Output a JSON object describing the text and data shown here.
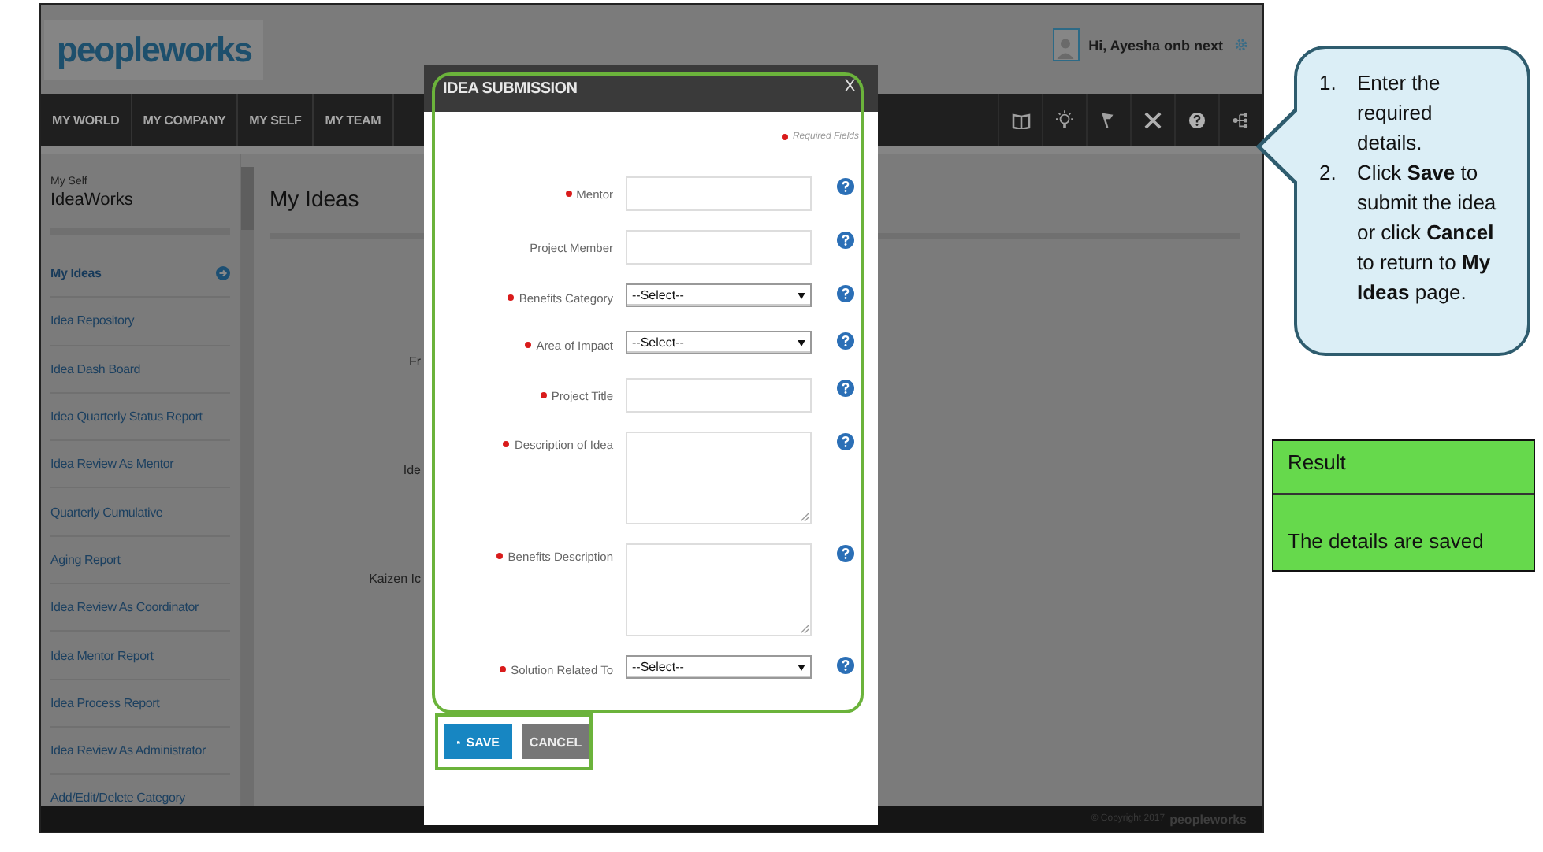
{
  "header": {
    "logo": "peopleworks",
    "greeting": "Hi, Ayesha onb next"
  },
  "nav": {
    "items": [
      {
        "label": "MY WORLD"
      },
      {
        "label": "MY COMPANY"
      },
      {
        "label": "MY SELF"
      },
      {
        "label": "MY TEAM"
      }
    ]
  },
  "sidebar": {
    "section": "My Self",
    "title": "IdeaWorks",
    "items": [
      {
        "label": "My Ideas",
        "selected": true
      },
      {
        "label": "Idea Repository",
        "selected": false
      },
      {
        "label": "Idea Dash Board",
        "selected": false
      },
      {
        "label": "Idea Quarterly Status Report",
        "selected": false
      },
      {
        "label": "Idea Review As Mentor",
        "selected": false
      },
      {
        "label": "Quarterly Cumulative",
        "selected": false
      },
      {
        "label": "Aging Report",
        "selected": false
      },
      {
        "label": "Idea Review As Coordinator",
        "selected": false
      },
      {
        "label": "Idea Mentor Report",
        "selected": false
      },
      {
        "label": "Idea Process Report",
        "selected": false
      },
      {
        "label": "Idea Review As Administrator",
        "selected": false
      },
      {
        "label": "Add/Edit/Delete Category",
        "selected": false
      }
    ]
  },
  "main": {
    "title": "My Ideas",
    "labels": [
      "Fr",
      "Ide",
      "Kaizen Ic"
    ]
  },
  "modal": {
    "title": "IDEA SUBMISSION",
    "close": "X",
    "required_note": "Required Fields",
    "fields": [
      {
        "label": "Mentor",
        "required": true,
        "kind": "text"
      },
      {
        "label": "Project Member",
        "required": false,
        "kind": "text"
      },
      {
        "label": "Benefits Category",
        "required": true,
        "kind": "select",
        "value": "--Select--"
      },
      {
        "label": "Area of Impact",
        "required": true,
        "kind": "select",
        "value": "--Select--"
      },
      {
        "label": "Project Title",
        "required": true,
        "kind": "text"
      },
      {
        "label": "Description of Idea",
        "required": true,
        "kind": "textarea"
      },
      {
        "label": "Benefits Description",
        "required": true,
        "kind": "textarea"
      },
      {
        "label": "Solution Related To",
        "required": true,
        "kind": "select",
        "value": "--Select--"
      }
    ],
    "buttons": [
      {
        "label": "SAVE",
        "kind": "primary"
      },
      {
        "label": "CANCEL",
        "kind": "secondary"
      }
    ]
  },
  "footer": {
    "copyright": "© Copyright 2017",
    "logo": "peopleworks"
  },
  "callout": {
    "steps": [
      {
        "number": "1.",
        "text": "Enter the required details."
      },
      {
        "number": "2.",
        "text": "Click **Save** to submit the idea or click **Cancel** to return to **My Ideas** page."
      }
    ]
  },
  "result": {
    "heading": "Result",
    "text": "The details  are saved"
  }
}
